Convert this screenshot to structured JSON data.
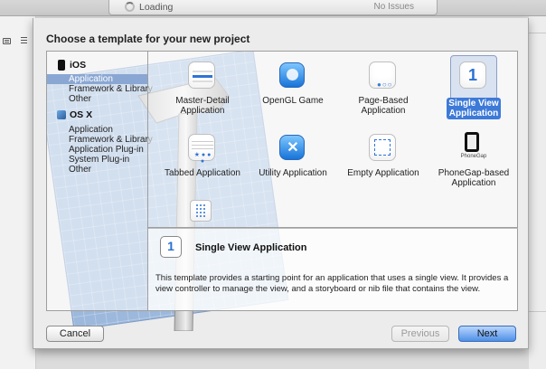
{
  "toolbar": {
    "activity_status": "Loading",
    "issues_status": "No Issues"
  },
  "dialog": {
    "title": "Choose a template for your new project",
    "categories": [
      {
        "label": "iOS",
        "icon": "iphone-icon",
        "items": [
          {
            "label": "Application",
            "selected": true
          },
          {
            "label": "Framework & Library",
            "selected": false
          },
          {
            "label": "Other",
            "selected": false
          }
        ]
      },
      {
        "label": "OS X",
        "icon": "finder-icon",
        "items": [
          {
            "label": "Application",
            "selected": false
          },
          {
            "label": "Framework & Library",
            "selected": false
          },
          {
            "label": "Application Plug-in",
            "selected": false
          },
          {
            "label": "System Plug-in",
            "selected": false
          },
          {
            "label": "Other",
            "selected": false
          }
        ]
      }
    ],
    "templates": [
      {
        "label": "Master-Detail Application",
        "icon": "master-detail-icon",
        "selected": false
      },
      {
        "label": "OpenGL Game",
        "icon": "opengl-game-icon",
        "selected": false
      },
      {
        "label": "Page-Based Application",
        "icon": "page-based-icon",
        "selected": false
      },
      {
        "label": "Single View Application",
        "icon": "single-view-icon",
        "icon_text": "1",
        "selected": true
      },
      {
        "label": "Tabbed Application",
        "icon": "tabbed-icon",
        "selected": false
      },
      {
        "label": "Utility Application",
        "icon": "utility-icon",
        "selected": false
      },
      {
        "label": "Empty Application",
        "icon": "empty-app-icon",
        "selected": false
      },
      {
        "label": "PhoneGap-based Application",
        "icon": "phonegap-icon",
        "icon_text": "PhoneGap",
        "selected": false
      },
      {
        "label": "",
        "icon": "xcode-game-icon",
        "selected": false
      }
    ],
    "detail": {
      "icon_text": "1",
      "title": "Single View Application",
      "description": "This template provides a starting point for an application that uses a single view. It provides a view controller to manage the view, and a storyboard or nib file that contains the view."
    },
    "buttons": {
      "cancel": "Cancel",
      "previous": "Previous",
      "next": "Next"
    }
  },
  "colors": {
    "selection_blue": "#3d7ad8",
    "list_selection": "#8aa7d3",
    "blueprint": "#9cb8dc"
  }
}
